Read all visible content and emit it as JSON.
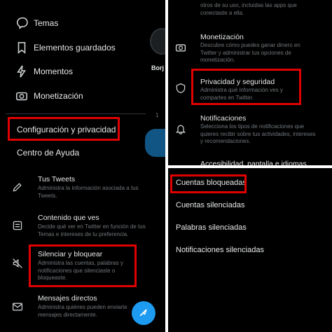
{
  "colors": {
    "background": "#000000",
    "highlight": "#e00000",
    "accent": "#1d9bf0",
    "muted": "#71767b"
  },
  "left_menu": {
    "items": [
      {
        "label": "Temas",
        "icon": "topics-icon"
      },
      {
        "label": "Elementos guardados",
        "icon": "bookmark-icon"
      },
      {
        "label": "Momentos",
        "icon": "lightning-icon"
      },
      {
        "label": "Monetización",
        "icon": "monetization-icon"
      }
    ],
    "settings_label": "Configuración y privacidad",
    "help_label": "Centro de Ayuda",
    "profile_fragment": "Borj",
    "count_fragment": "1"
  },
  "left_settings": {
    "items": [
      {
        "title": "Tus Tweets",
        "desc": "Administra la información asociada a tus Tweets.",
        "icon": "pencil-icon"
      },
      {
        "title": "Contenido que ves",
        "desc": "Decide qué ver en Twitter en función de tus Temas e intereses de tu preferencia.",
        "icon": "content-icon"
      },
      {
        "title": "Silenciar y bloquear",
        "desc": "Administra las cuentas, palabras y notificaciones que silenciaste o bloqueaste.",
        "icon": "mute-icon"
      },
      {
        "title": "Mensajes directos",
        "desc": "Administra quiénes pueden enviarte mensajes directamente.",
        "icon": "mail-icon"
      }
    ]
  },
  "right_settings": {
    "top_fragment": "otros de su uso, incluidas las apps que conectaste a ella.",
    "items": [
      {
        "title": "Monetización",
        "desc": "Descubre cómo puedes ganar dinero en Twitter y administrar tus opciones de monetización.",
        "icon": "monetization-icon"
      },
      {
        "title": "Privacidad y seguridad",
        "desc": "Administra qué información ves y compartes en Twitter.",
        "icon": "shield-icon"
      },
      {
        "title": "Notificaciones",
        "desc": "Selecciona los tipos de notificaciones que quieres recibir sobre tus actividades, intereses y recomendaciones.",
        "icon": "bell-icon"
      }
    ],
    "bottom_fragment": "Accesibilidad, pantalla e idiomas"
  },
  "mute_block_menu": {
    "items": [
      "Cuentas bloqueadas",
      "Cuentas silenciadas",
      "Palabras silenciadas",
      "Notificaciones silenciadas"
    ]
  }
}
